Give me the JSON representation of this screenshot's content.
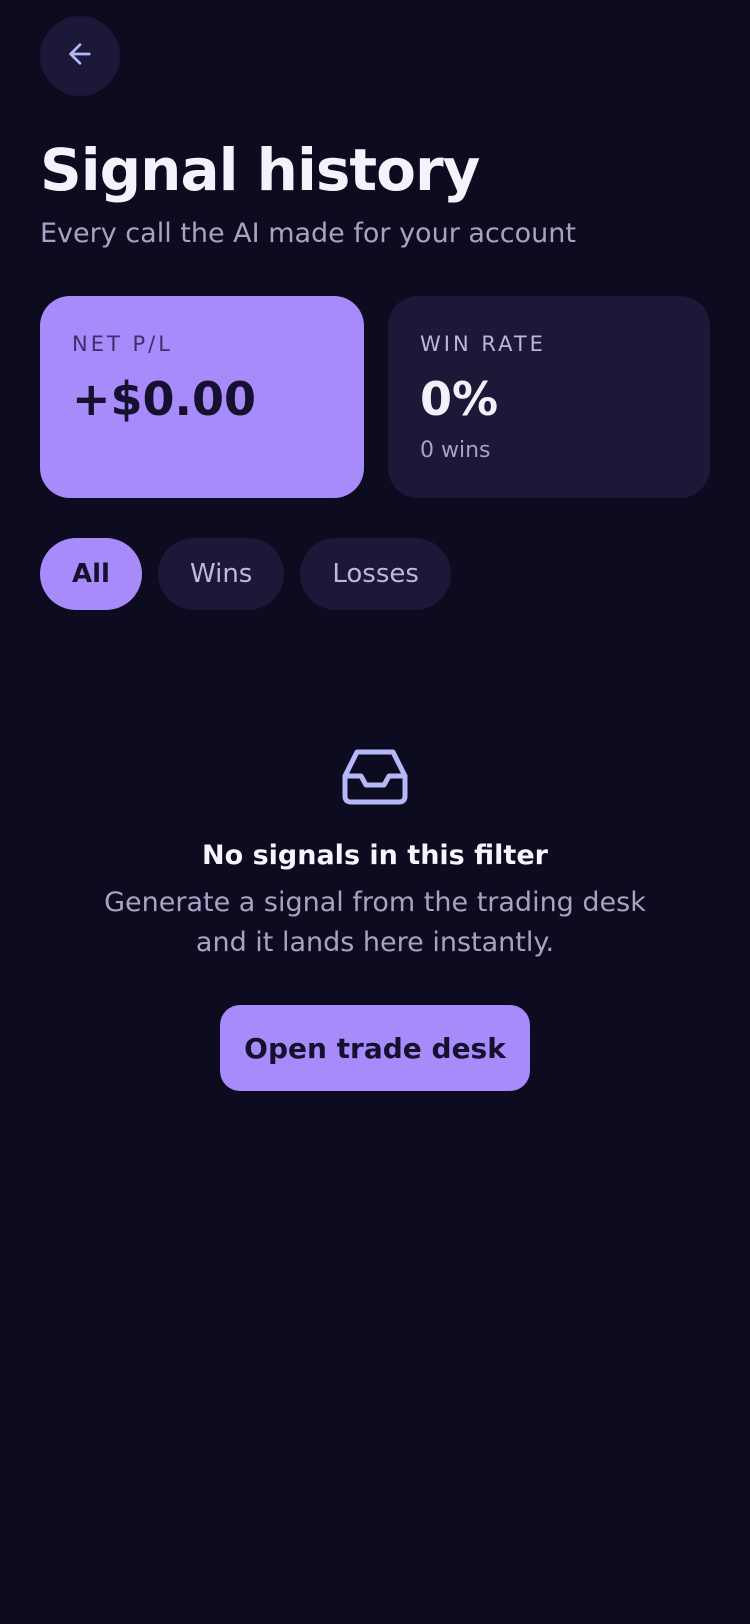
{
  "header": {
    "back_icon": "arrow-left-icon",
    "title": "Signal history",
    "subtitle": "Every call the AI made for your account"
  },
  "stats": {
    "net_pl": {
      "label": "NET P/L",
      "value": "+$0.00"
    },
    "win_rate": {
      "label": "WIN RATE",
      "value": "0%",
      "sub": "0 wins"
    }
  },
  "filters": {
    "items": [
      "All",
      "Wins",
      "Losses"
    ],
    "selected": "All"
  },
  "empty_state": {
    "icon": "inbox-icon",
    "title": "No signals in this filter",
    "text": "Generate a signal from the trading desk and it lands here instantly.",
    "button_label": "Open trade desk"
  },
  "colors": {
    "background": "#0c0b1f",
    "surface": "#1b1838",
    "accent": "#a78bfa",
    "icon_accent": "#b4b8f8",
    "muted_text": "#a7a3c4"
  }
}
